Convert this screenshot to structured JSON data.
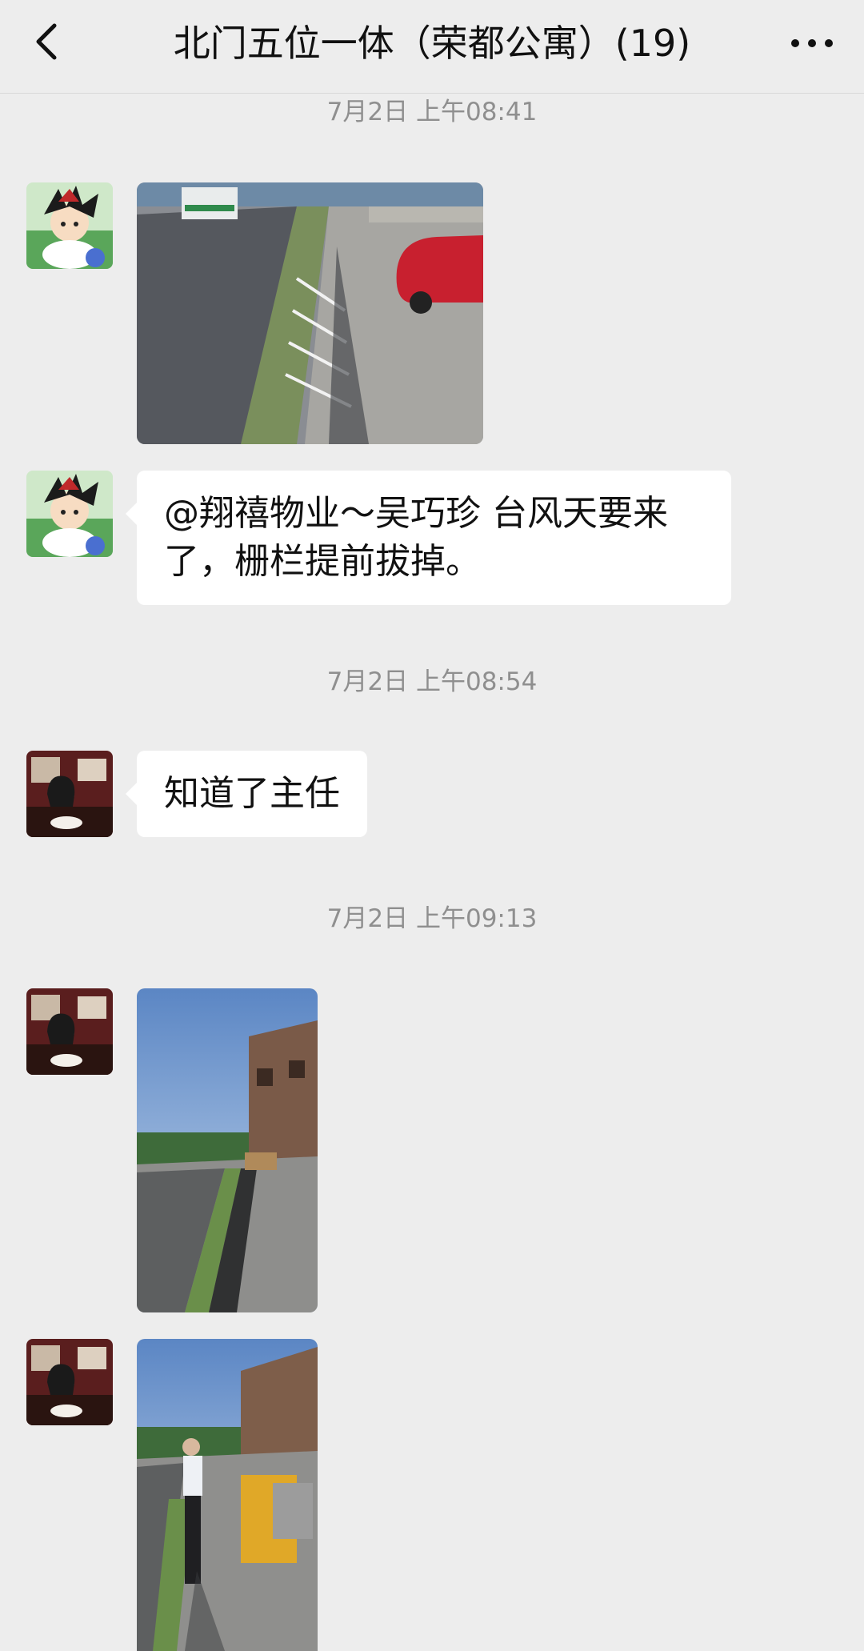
{
  "header": {
    "title": "北门五位一体（荣都公寓）(19)",
    "back_icon": "chevron-left-icon",
    "more_icon": "more-dots-icon"
  },
  "messages": [
    {
      "type": "timestamp",
      "text": "7月2日 上午08:41"
    },
    {
      "type": "image",
      "sender_avatar": "anime-avatar",
      "content": "street-fence-photo"
    },
    {
      "type": "text",
      "sender_avatar": "anime-avatar",
      "text": "@翔禧物业～吴巧珍  台风天要来了，栅栏提前拔掉。"
    },
    {
      "type": "timestamp",
      "text": "7月2日 上午08:54"
    },
    {
      "type": "text",
      "sender_avatar": "woman-avatar",
      "text": "知道了主任"
    },
    {
      "type": "timestamp",
      "text": "7月2日 上午09:13"
    },
    {
      "type": "image",
      "sender_avatar": "woman-avatar",
      "content": "sidewalk-sky-photo"
    },
    {
      "type": "image",
      "sender_avatar": "woman-avatar",
      "content": "worker-removing-fence-photo"
    }
  ],
  "colors": {
    "background": "#ededed",
    "bubble": "#ffffff",
    "timestamp": "#8f8f8f"
  }
}
